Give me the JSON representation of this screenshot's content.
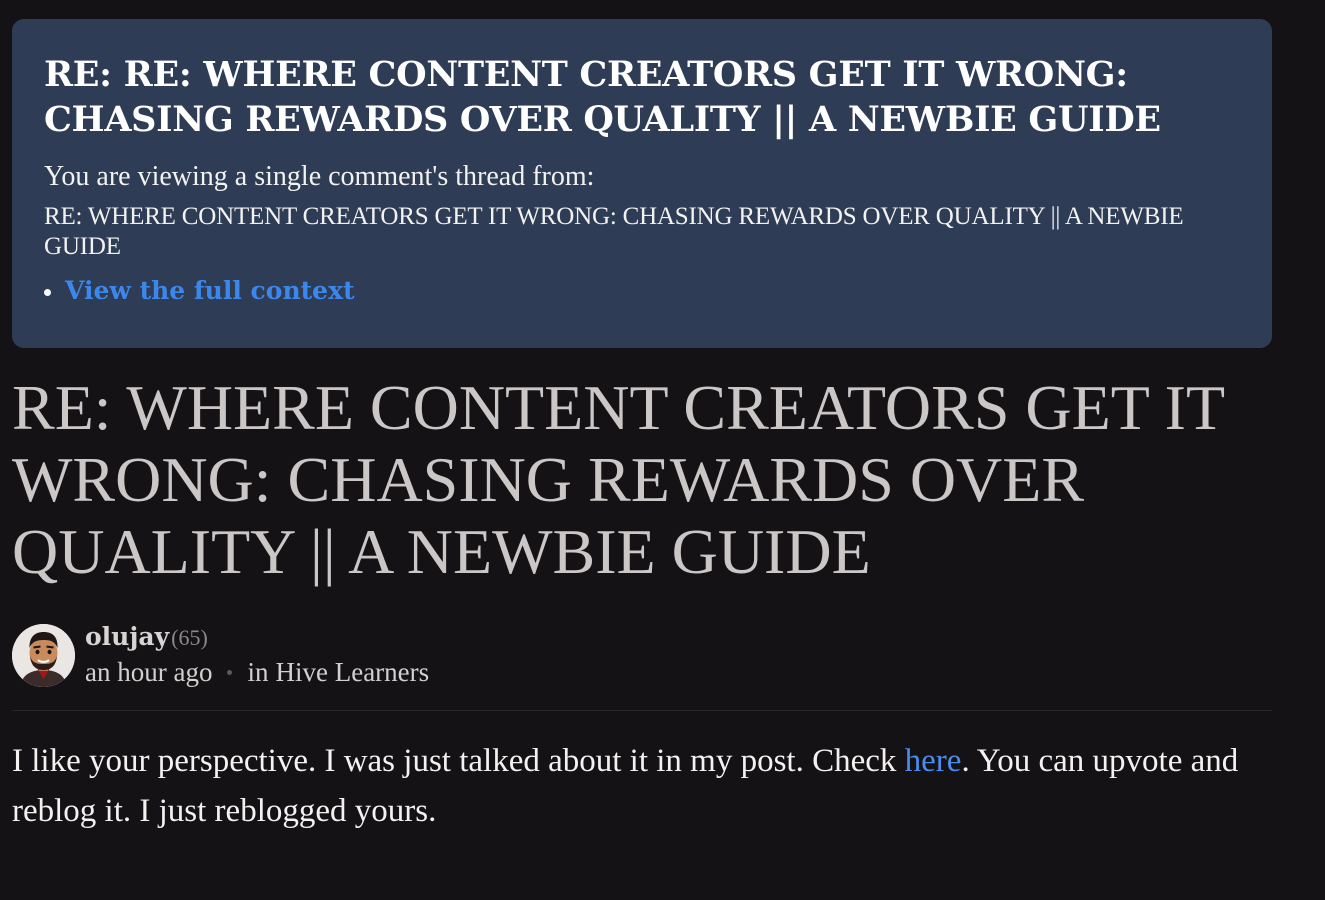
{
  "context": {
    "title": "RE: RE: WHERE CONTENT CREATORS GET IT WRONG: CHASING REWARDS OVER QUALITY || A NEWBIE GUIDE",
    "subtitle": "You are viewing a single comment's thread from:",
    "parent_title": "RE: WHERE CONTENT CREATORS GET IT WRONG: CHASING REWARDS OVER QUALITY || A NEWBIE GUIDE",
    "link_label": "View the full context"
  },
  "post": {
    "title": "RE: WHERE CONTENT CREATORS GET IT WRONG: CHASING REWARDS OVER QUALITY || A NEWBIE GUIDE",
    "author": "olujay",
    "reputation": "(65)",
    "time": "an hour ago",
    "community_prefix": "in",
    "community": "Hive Learners",
    "avatar_icon": "avatar-icon"
  },
  "comment": {
    "text_before_link": "I like your perspective. I was just talked about it in my post. Check ",
    "link_text": "here",
    "text_after_link": ". You can upvote and reblog it. I just reblogged yours."
  },
  "colors": {
    "background": "#141214",
    "context_box": "#2e3d55",
    "link": "#3c87ec",
    "title_text": "#cbc7c7"
  }
}
